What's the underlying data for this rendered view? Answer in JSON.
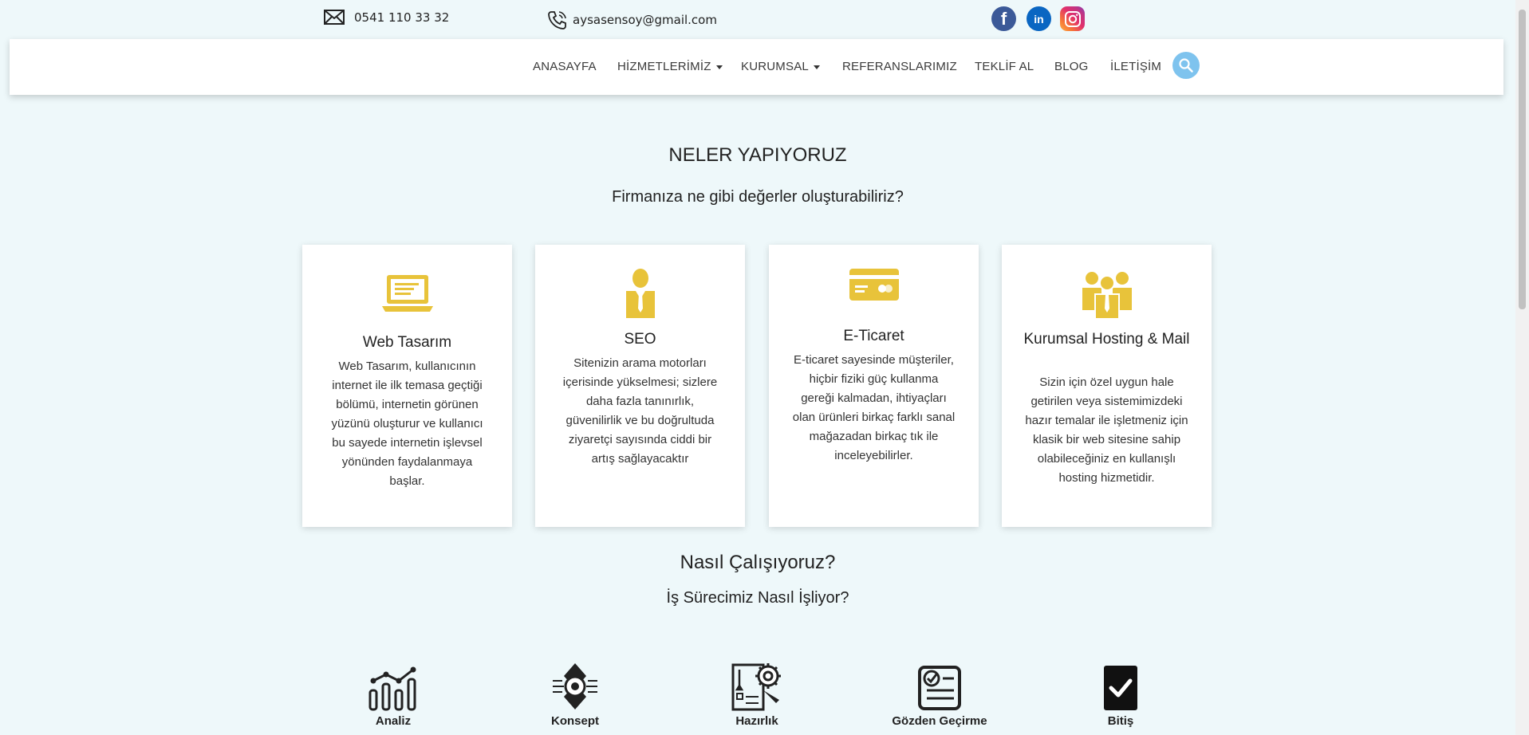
{
  "contact": {
    "phone": "0541 110 33 32",
    "email": "aysasensoy@gmail.com"
  },
  "social": {
    "facebook": "f",
    "linkedin": "in"
  },
  "nav": {
    "items": [
      "ANASAYFA",
      "HİZMETLERİMİZ",
      "KURUMSAL",
      "REFERANSLARIMIZ",
      "TEKLİF AL",
      "BLOG",
      "İLETİŞİM"
    ]
  },
  "services": {
    "title": "NELER YAPIYORUZ",
    "subtitle": "Firmanıza ne gibi değerler oluşturabiliriz?",
    "cards": [
      {
        "title": "Web Tasarım",
        "text": "Web Tasarım, kullanıcının internet ile ilk temasa geçtiği bölümü, internetin görünen yüzünü oluşturur ve kullanıcı bu sayede internetin işlevsel yönünden faydalanmaya başlar.",
        "icon": "laptop-icon"
      },
      {
        "title": "SEO",
        "text": "Sitenizin arama motorları içerisinde yükselmesi; sizlere daha fazla tanınırlık, güvenilirlik ve bu doğrultuda ziyaretçi sayısında ciddi bir artış sağlayacaktır",
        "icon": "businessman-icon"
      },
      {
        "title": "E-Ticaret",
        "text": "E-ticaret sayesinde müşteriler, hiçbir fiziki güç kullanma gereği kalmadan, ihtiyaçları olan ürünleri birkaç farklı sanal mağazadan birkaç tık ile inceleyebilirler.",
        "icon": "credit-card-icon"
      },
      {
        "title": "Kurumsal Hosting & Mail",
        "text": "Sizin için özel uygun hale getirilen veya sistemimizdeki hazır temalar ile işletmeniz için klasik bir web sitesine sahip olabileceğiniz en kullanışlı hosting hizmetidir.",
        "icon": "team-icon"
      }
    ]
  },
  "process": {
    "title": "Nasıl Çalışıyoruz?",
    "subtitle": "İş Sürecimiz Nasıl İşliyor?",
    "steps": [
      {
        "label": "Analiz",
        "icon": "chart-icon"
      },
      {
        "label": "Konsept",
        "icon": "concept-icon"
      },
      {
        "label": "Hazırlık",
        "icon": "preparation-icon"
      },
      {
        "label": "Gözden Geçirme",
        "icon": "review-icon"
      },
      {
        "label": "Bitiş",
        "icon": "checkmark-icon"
      }
    ]
  },
  "colors": {
    "accent": "#e8c33a",
    "background": "#eef8fa",
    "search": "#7ec3ee"
  }
}
